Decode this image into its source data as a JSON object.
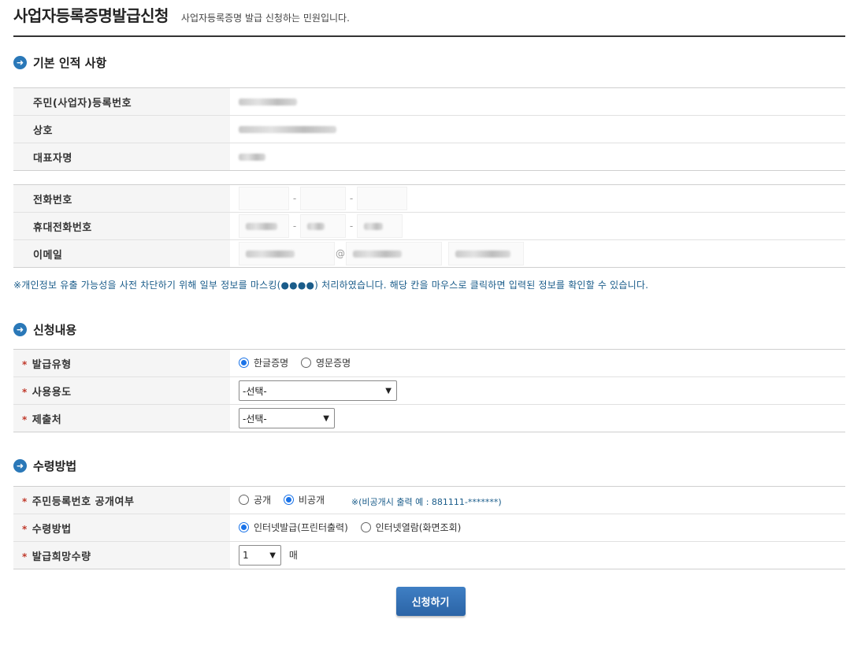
{
  "header": {
    "title": "사업자등록증명발급신청",
    "subtitle": "사업자등록증명 발급 신청하는 민원입니다."
  },
  "basic_info": {
    "section_title": "기본 인적 사항",
    "rows": [
      {
        "label": "주민(사업자)등록번호"
      },
      {
        "label": "상호"
      },
      {
        "label": "대표자명"
      }
    ]
  },
  "contact": {
    "rows": [
      {
        "label": "전화번호"
      },
      {
        "label": "휴대전화번호"
      },
      {
        "label": "이메일"
      }
    ]
  },
  "notice": "※개인정보 유출 가능성을 사전 차단하기 위해 일부 정보를 마스킹(●●●●) 처리하였습니다. 해당 칸을 마우스로 클릭하면 입력된 정보를 확인할 수 있습니다.",
  "application": {
    "section_title": "신청내용",
    "required_mark": "*",
    "issue_type": {
      "label": "발급유형",
      "options": [
        "한글증명",
        "영문증명"
      ],
      "selected": "한글증명"
    },
    "usage": {
      "label": "사용용도",
      "value": "-선택-"
    },
    "submit_to": {
      "label": "제출처",
      "value": "-선택-"
    }
  },
  "receipt": {
    "section_title": "수령방법",
    "disclose": {
      "label": "주민등록번호 공개여부",
      "options": [
        "공개",
        "비공개"
      ],
      "selected": "비공개",
      "hint": "※(비공개시 출력 예 : 881111-*******)"
    },
    "method": {
      "label": "수령방법",
      "options": [
        "인터넷발급(프린터출력)",
        "인터넷열람(화면조회)"
      ],
      "selected": "인터넷발급(프린터출력)"
    },
    "quantity": {
      "label": "발급희망수량",
      "value": "1",
      "unit": "매"
    }
  },
  "actions": {
    "submit_label": "신청하기"
  },
  "colors": {
    "accent": "#2a78b8",
    "button": "#2f6bb0",
    "required": "#c0392b",
    "notice": "#1a5c8a"
  }
}
